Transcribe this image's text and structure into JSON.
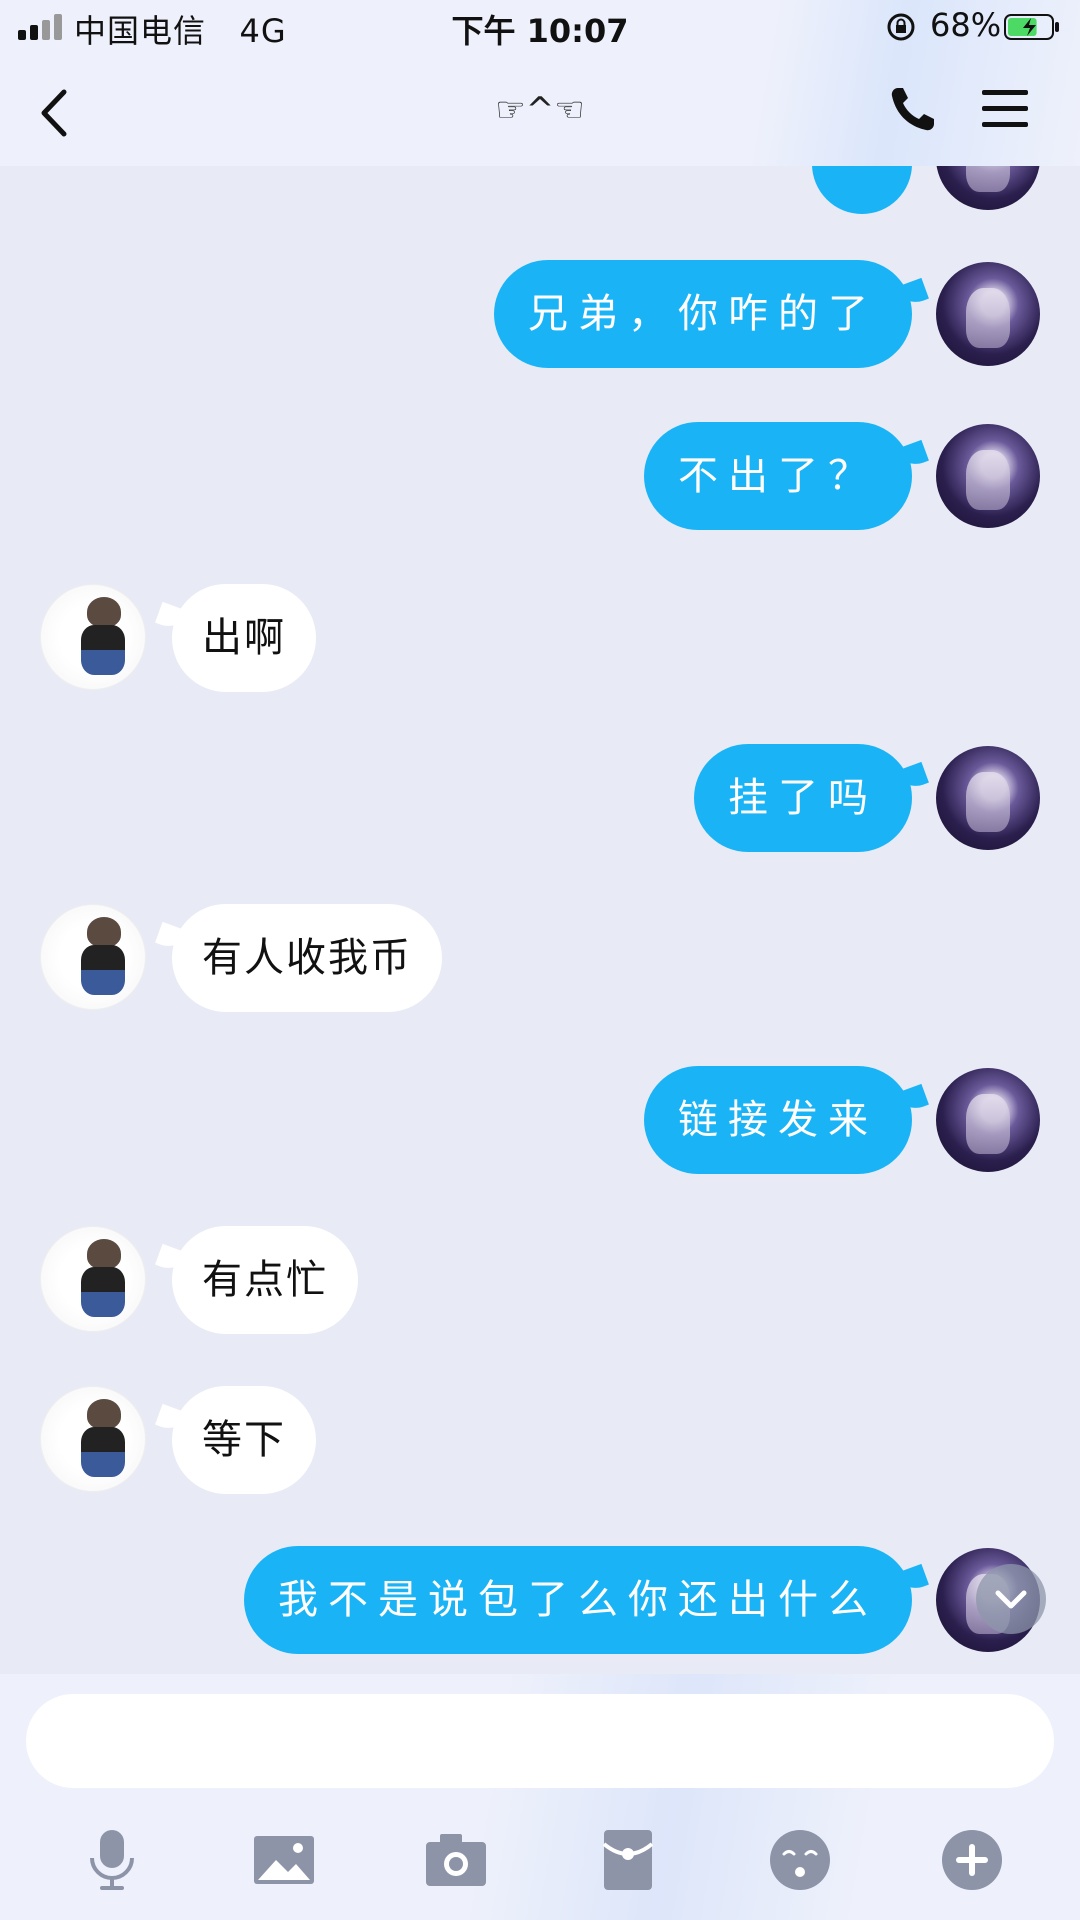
{
  "status": {
    "carrier": "中国电信",
    "network": "4G",
    "time": "下午 10:07",
    "battery": "68%",
    "battery_level": 0.68
  },
  "header": {
    "title": "☞^☜"
  },
  "messages": [
    {
      "from": "me",
      "text": "兄弟，你咋的了"
    },
    {
      "from": "me",
      "text": "不出了？"
    },
    {
      "from": "them",
      "text": "出啊"
    },
    {
      "from": "me",
      "text": "挂了吗"
    },
    {
      "from": "them",
      "text": "有人收我币"
    },
    {
      "from": "me",
      "text": "链接发来"
    },
    {
      "from": "them",
      "text": "有点忙"
    },
    {
      "from": "them",
      "text": "等下"
    },
    {
      "from": "me",
      "text": "我不是说包了么你还出什么"
    }
  ],
  "input": {
    "value": "",
    "placeholder": ""
  },
  "toolbar": {
    "icons": [
      "microphone-icon",
      "image-icon",
      "camera-icon",
      "red-packet-icon",
      "emoji-icon",
      "plus-icon"
    ]
  },
  "colors": {
    "accent": "#1ab4f6",
    "background": "#e8ebf6",
    "icon": "#8d94a8"
  }
}
